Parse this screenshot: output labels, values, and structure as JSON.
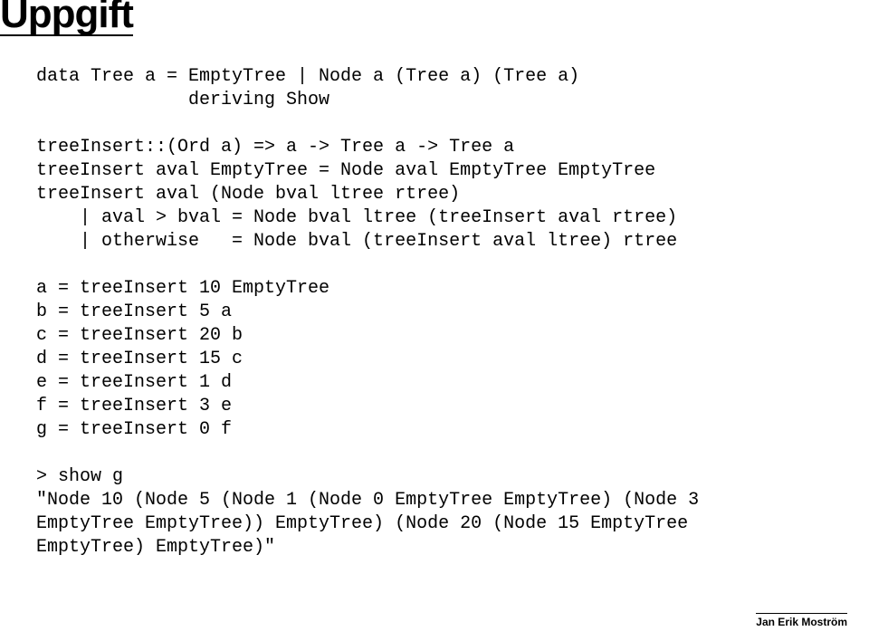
{
  "slide": {
    "title": "Uppgift",
    "footer": "Jan Erik Moström",
    "code_lines": [
      "data Tree a = EmptyTree | Node a (Tree a) (Tree a)",
      "              deriving Show",
      "",
      "treeInsert::(Ord a) => a -> Tree a -> Tree a",
      "treeInsert aval EmptyTree = Node aval EmptyTree EmptyTree",
      "treeInsert aval (Node bval ltree rtree)",
      "    | aval > bval = Node bval ltree (treeInsert aval rtree)",
      "    | otherwise   = Node bval (treeInsert aval ltree) rtree",
      "",
      "a = treeInsert 10 EmptyTree",
      "b = treeInsert 5 a",
      "c = treeInsert 20 b",
      "d = treeInsert 15 c",
      "e = treeInsert 1 d",
      "f = treeInsert 3 e",
      "g = treeInsert 0 f",
      "",
      "> show g",
      "\"Node 10 (Node 5 (Node 1 (Node 0 EmptyTree EmptyTree) (Node 3 ",
      "EmptyTree EmptyTree)) EmptyTree) (Node 20 (Node 15 EmptyTree ",
      "EmptyTree) EmptyTree)\""
    ]
  }
}
